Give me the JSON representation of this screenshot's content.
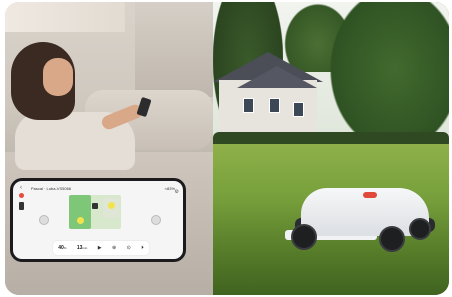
{
  "phone": {
    "title": "Pascal · Luba-VS5066",
    "status": "≈83%",
    "back_glyph": "‹",
    "right_glyphs": "⚙",
    "stat1_value": "40",
    "stat1_unit": "%",
    "stat2_value": "13",
    "stat2_unit": "min",
    "controls": [
      "▶",
      "⊕",
      "⊙",
      "⏵"
    ]
  },
  "colors": {
    "lawn": "#7aa23d",
    "mower_shell": "#f2f3f4",
    "map_zone": "#7ec779",
    "accent_red": "#e04a3a"
  }
}
